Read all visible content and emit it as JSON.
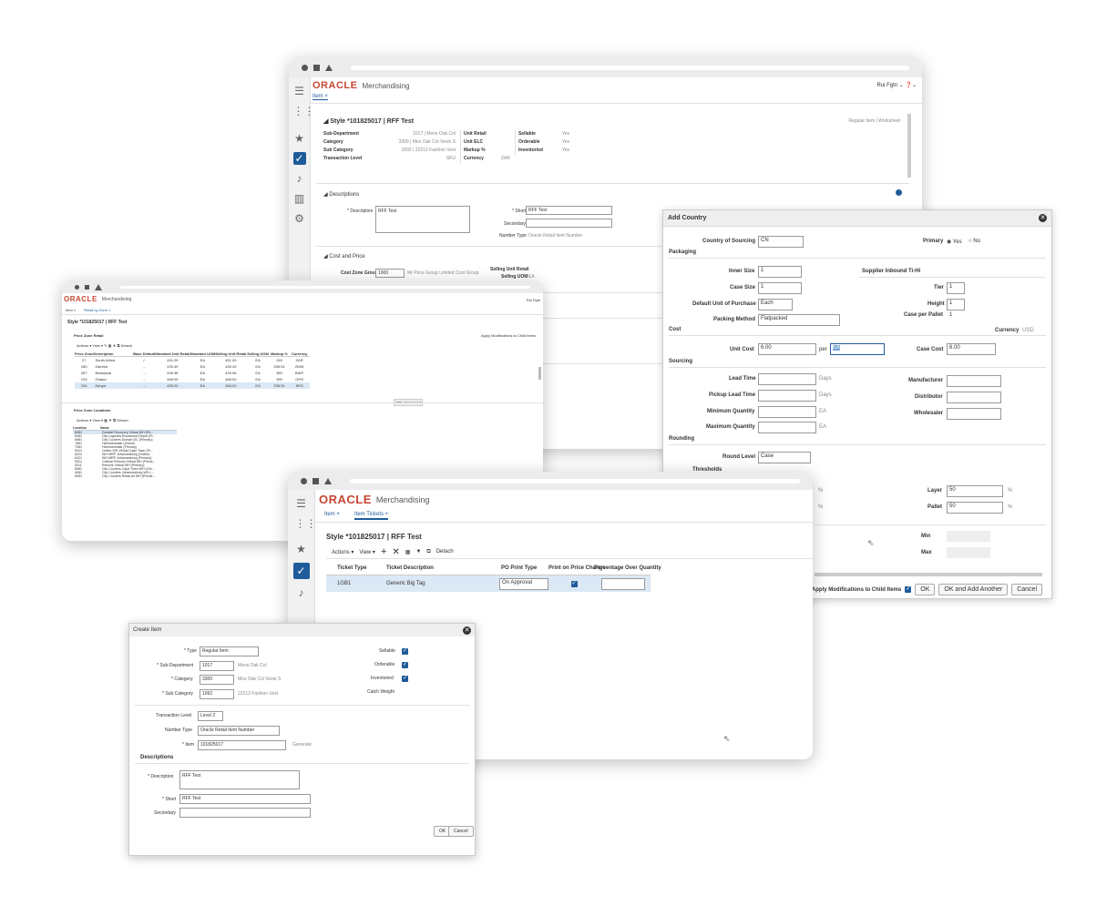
{
  "brand": {
    "logo": "ORACLE",
    "product": "Merchandising"
  },
  "w1": {
    "user": "Rui Fgtn ⌄ ❓⌄",
    "tab": "Item",
    "style_title": "Style *101825017 | RFF Test",
    "regular_links": "Regular Item | Worksheet",
    "summary": [
      {
        "k": "Sub-Department",
        "v": "1017 | Mens Oak Col"
      },
      {
        "k": "Category",
        "v": "3300 | Mns Oak Col Vests S"
      },
      {
        "k": "Sub Category",
        "v": "1092 | 22212 Fashion Vest"
      },
      {
        "k": "Transaction Level",
        "v": "SKU"
      }
    ],
    "summary2": [
      {
        "k": "Unit Retail",
        "v": ""
      },
      {
        "k": "Unit ELC",
        "v": ""
      },
      {
        "k": "Markup %",
        "v": ""
      },
      {
        "k": "Currency",
        "v": "ZAR"
      }
    ],
    "summary3": [
      {
        "k": "Sellable",
        "v": "Yes"
      },
      {
        "k": "Orderable",
        "v": "Yes"
      },
      {
        "k": "Inventoried",
        "v": "Yes"
      }
    ],
    "desc_section": "Descriptions",
    "desc_label": "* Description",
    "desc_value": "RFF Test",
    "short_label": "* Short",
    "short_value": "RFF Test",
    "secondary_label": "Secondary",
    "numtype_label": "Number Type",
    "numtype_value": "Oracle Retail Item Number",
    "cost_section": "Cost and Price",
    "cost_zone_label": "Cost Zone Group",
    "cost_zone_value": "1000",
    "cost_zone_desc": "Mr Price Group Limited Cost Group",
    "selling_unit_retail": "Selling Unit Retail",
    "selling_uom": "Selling UOM",
    "selling_uom_value": "EA"
  },
  "add_country": {
    "title": "Add Country",
    "country_label": "Country of Sourcing",
    "country_value": "CN",
    "primary_label": "Primary",
    "yes": "Yes",
    "no": "No",
    "packaging": "Packaging",
    "inner_size_label": "Inner Size",
    "inner_size": "1",
    "supplier_tihi": "Supplier Inbound Ti-Hi",
    "case_size_label": "Case Size",
    "case_size": "1",
    "tier_label": "Tier",
    "tier": "1",
    "duop_label": "Default Unit of Purchase",
    "duop": "Each",
    "height_label": "Height",
    "height": "1",
    "packing_label": "Packing Method",
    "packing": "Flatpacked",
    "case_pallet_label": "Case per Pallet",
    "case_pallet": "1",
    "cost": "Cost",
    "currency_label": "Currency",
    "currency": "USD",
    "unit_cost_label": "Unit Cost",
    "unit_cost": "6.00",
    "per": "per",
    "per_value": "EA",
    "case_cost_label": "Case Cost",
    "case_cost": "6.00",
    "sourcing": "Sourcing",
    "lead_time": "Lead Time",
    "pickup_lead_time": "Pickup Lead Time",
    "days": "Days",
    "min_qty": "Minimum Quantity",
    "max_qty": "Maximum Quantity",
    "ea": "EA",
    "manufacturer": "Manufacturer",
    "distributor": "Distributor",
    "wholesaler": "Wholesaler",
    "rounding": "Rounding",
    "round_level_label": "Round Level",
    "round_level": "Case",
    "thresholds": "Thresholds",
    "pct": "%",
    "layer_label": "Layer",
    "layer": "50",
    "pallet_label": "Pallet",
    "pallet": "50",
    "min": "Min",
    "max": "Max",
    "apply_child": "Apply Modifications to Child Items",
    "ok": "OK",
    "ok_add": "OK and Add Another",
    "cancel": "Cancel"
  },
  "w2": {
    "user": "Rui Fgtn",
    "tabs": [
      "Item ×",
      "Retail by Zone ×"
    ],
    "style_title": "Style *101825017 | RFF Test",
    "pz_retail": "Price Zone Retail",
    "apply_mod": "Apply Modifications to Child Items",
    "toolbar": "Actions ▾  View ▾  ✎  ▦  ▼  ⧉ Detach",
    "headers": [
      "Price Zone",
      "Description",
      "Base Default",
      "Standard Unit Retail",
      "Standard UOM",
      "Selling Unit Retail",
      "Selling UOM",
      "Markup %",
      "Currency"
    ],
    "rows": [
      [
        "27",
        "South Africa",
        "✓",
        "451.00",
        "EA",
        "451.00",
        "EA",
        "249",
        "ZAR"
      ],
      [
        "280",
        "Zambia",
        "...",
        "439.49",
        "EA",
        "439.49",
        "EA",
        "335.51",
        "ZMW"
      ],
      [
        "287",
        "Botswana",
        "...",
        "439.56",
        "EA",
        "439.56",
        "EA",
        "360",
        "BWP"
      ],
      [
        "233",
        "Ghana",
        "...",
        "468.00",
        "EA",
        "468.00",
        "EA",
        "390",
        "GHS"
      ],
      [
        "234",
        "Kenya",
        "...",
        "455.20",
        "EA",
        "455.20",
        "EA",
        "335.51",
        "KES"
      ]
    ],
    "tooltip": "ZMW - Mark Created",
    "pz_locations": "Price Zone Locations",
    "loc_toolbar": "Actions ▾  View ▾  ▦  ▼  ⧉ Detach",
    "loc_headers": [
      "Location",
      "Name"
    ],
    "locs": [
      [
        "8081",
        "Doublet Recovery Virtual WH (Pri..."
      ],
      [
        "6081",
        "City Logistics Bromwood Depot (Pr..."
      ],
      [
        "6981",
        "City Couriers Durban DC (Primary)"
      ],
      [
        "7681",
        "Hammersdale (Online)"
      ],
      [
        "7081",
        "Hammersdale (Primary)"
      ],
      [
        "9021",
        "Online WH Virtual Cape Town (Pr..."
      ],
      [
        "6022",
        "WH MRP Johannesburg (Online)"
      ],
      [
        "6421",
        "WH MRP Johannesburg (Primary)"
      ],
      [
        "5021",
        "Cellular Returns Virtual WH (Prima..."
      ],
      [
        "5311",
        "Returns Virtual WH (Primary)"
      ],
      [
        "6081",
        "City Couriers Cape Town WH (Onl..."
      ],
      [
        "4081",
        "City Couriers Johannesburg WH (..."
      ],
      [
        "6081",
        "City Couriers Retail-all WH (Primar..."
      ]
    ]
  },
  "w3": {
    "tabs": [
      "Item",
      "Item Tickets"
    ],
    "style_title": "Style *101825017 | RFF Test",
    "toolbar": {
      "actions": "Actions ▾",
      "view": "View ▾",
      "detach": "Detach"
    },
    "headers": [
      "Ticket Type",
      "Ticket Description",
      "PO Print Type",
      "Print on Price Change",
      "Percentage Over Quantity"
    ],
    "row": {
      "type": "1GB1",
      "desc": "Generic Big Tag",
      "po": "On Approval"
    }
  },
  "create_item": {
    "title": "Create Item",
    "type_label": "* Type",
    "type_value": "Regular Item",
    "subdept_label": "* Sub-Department",
    "subdept_value": "1017",
    "subdept_desc": "Mens Oak Col",
    "cat_label": "* Category",
    "cat_value": "3300",
    "cat_desc": "Mns Oak Col Vests S",
    "subcat_label": "* Sub Category",
    "subcat_value": "1092",
    "subcat_desc": "22212 Fashion Vest",
    "sellable": "Sellable",
    "orderable": "Orderable",
    "inventoried": "Inventoried",
    "catch_weight": "Catch Weight",
    "trans_level_label": "Transaction Level",
    "trans_level": "Level 2",
    "number_type_label": "Number Type",
    "number_type": "Oracle Retail Item Number",
    "item_label": "* Item",
    "item_value": "101825017",
    "generate": "Generate",
    "descriptions": "Descriptions",
    "desc_label": "* Description",
    "desc_value": "RFF Test",
    "short_label": "* Short",
    "short_value": "RFF Test",
    "secondary_label": "Secondary",
    "ok": "OK",
    "cancel": "Cancel"
  }
}
